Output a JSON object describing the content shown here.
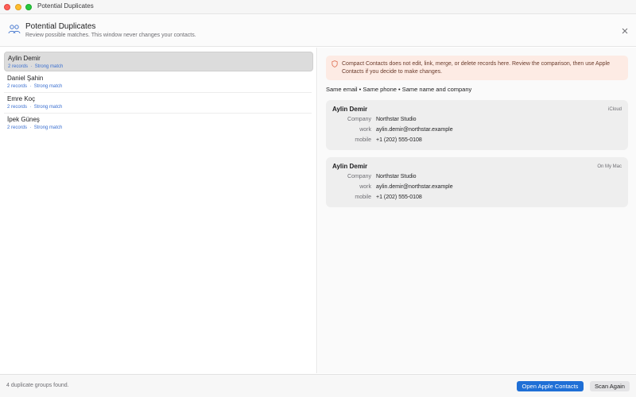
{
  "window": {
    "title": "Potential Duplicates"
  },
  "header": {
    "title": "Potential Duplicates",
    "subtitle": "Review possible matches. This window never changes your contacts.",
    "icon": "people-pair-icon",
    "close_icon": "close-icon"
  },
  "groups": [
    {
      "name": "Aylin Demir",
      "records": "2 records",
      "separator": "·",
      "strength": "Strong match",
      "selected": true
    },
    {
      "name": "Daniel Şahin",
      "records": "2 records",
      "separator": "·",
      "strength": "Strong match",
      "selected": false
    },
    {
      "name": "Emre Koç",
      "records": "2 records",
      "separator": "·",
      "strength": "Strong match",
      "selected": false
    },
    {
      "name": "İpek Güneş",
      "records": "2 records",
      "separator": "·",
      "strength": "Strong match",
      "selected": false
    }
  ],
  "detail": {
    "notice": "Compact Contacts does not edit, link, merge, or delete records here. Review the comparison, then use Apple Contacts if you decide to make changes.",
    "notice_icon": "shield-icon",
    "reasons": "Same email • Same phone • Same name and company",
    "cards": [
      {
        "name": "Aylin Demir",
        "source": "iCloud",
        "fields": [
          {
            "label": "Company",
            "value": "Northstar Studio"
          },
          {
            "label": "work",
            "value": "aylin.demir@northstar.example"
          },
          {
            "label": "mobile",
            "value": "+1 (202) 555-0108"
          }
        ]
      },
      {
        "name": "Aylin Demir",
        "source": "On My Mac",
        "fields": [
          {
            "label": "Company",
            "value": "Northstar Studio"
          },
          {
            "label": "work",
            "value": "aylin.demir@northstar.example"
          },
          {
            "label": "mobile",
            "value": "+1 (202) 555-0108"
          }
        ]
      }
    ]
  },
  "footer": {
    "status": "4 duplicate groups found.",
    "open_button": "Open Apple Contacts",
    "scan_button": "Scan Again"
  },
  "colors": {
    "accent": "#1f6fd6",
    "match_text": "#3a6fd0",
    "notice_bg": "#fdebe4",
    "notice_icon": "#e07a5f"
  }
}
